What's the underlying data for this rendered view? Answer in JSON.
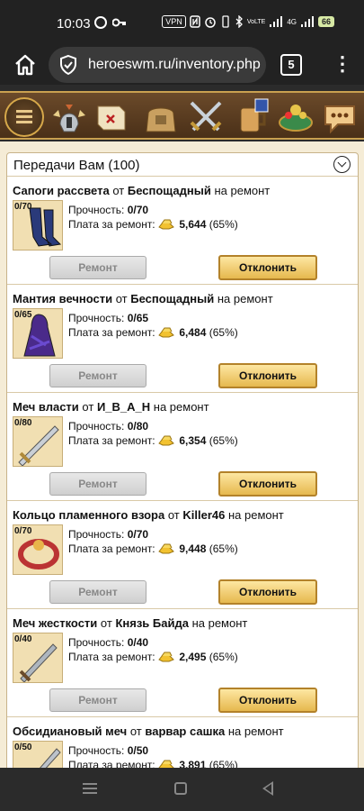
{
  "status": {
    "time": "10:03",
    "vpn": "VPN",
    "battery": "66",
    "net": "4G"
  },
  "browser": {
    "url": "heroeswm.ru/inventory.php",
    "tab_count": "5"
  },
  "panel": {
    "title": "Передачи Вам (100)"
  },
  "labels": {
    "durability": "Прочность:",
    "payment": "Плата за ремонт:",
    "from": "от",
    "for_repair": "на ремонт",
    "repair_button": "Ремонт",
    "decline_button": "Отклонить"
  },
  "items": [
    {
      "name": "Сапоги рассвета",
      "sender": "Беспощадный",
      "durability": "0/70",
      "thumb": "0/70",
      "price": "5,644",
      "percent": "(65%)"
    },
    {
      "name": "Мантия вечности",
      "sender": "Беспощадный",
      "durability": "0/65",
      "thumb": "0/65",
      "price": "6,484",
      "percent": "(65%)"
    },
    {
      "name": "Меч власти",
      "sender": "И_В_А_Н",
      "durability": "0/80",
      "thumb": "0/80",
      "price": "6,354",
      "percent": "(65%)"
    },
    {
      "name": "Кольцо пламенного взора",
      "sender": "Killer46",
      "durability": "0/70",
      "thumb": "0/70",
      "price": "9,448",
      "percent": "(65%)"
    },
    {
      "name": "Меч жесткости",
      "sender": "Князь Байда",
      "durability": "0/40",
      "thumb": "0/40",
      "price": "2,495",
      "percent": "(65%)"
    },
    {
      "name": "Обсидиановый меч",
      "sender": "варвар сашка",
      "durability": "0/50",
      "thumb": "0/50",
      "price": "3,891",
      "percent": "(65%)"
    }
  ],
  "colors": {
    "gold_button": "#e6b84e",
    "page_bg": "#f5ecd6",
    "nav_bg": "#4a3018"
  }
}
